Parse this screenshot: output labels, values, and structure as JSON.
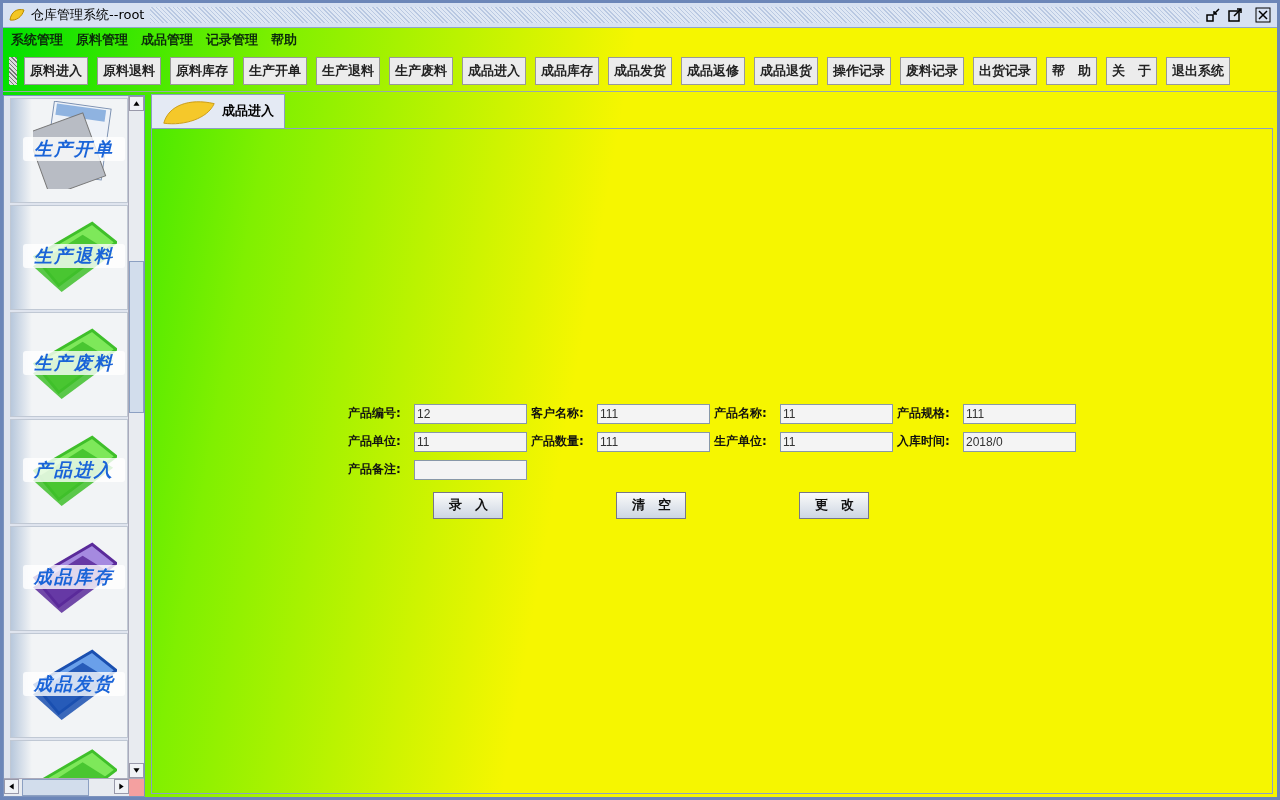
{
  "window": {
    "title": "仓库管理系统--root"
  },
  "menu": [
    "系统管理",
    "原料管理",
    "成品管理",
    "记录管理",
    "帮助"
  ],
  "toolbar": [
    "原料进入",
    "原料退料",
    "原料库存",
    "生产开单",
    "生产退料",
    "生产废料",
    "成品进入",
    "成品库存",
    "成品发货",
    "成品返修",
    "成品退货",
    "操作记录",
    "废料记录",
    "出货记录",
    "帮　助",
    "关　于",
    "退出系统"
  ],
  "sidebar": {
    "items": [
      {
        "label": "生产开单",
        "kind": "document"
      },
      {
        "label": "生产退料",
        "kind": "green-folder"
      },
      {
        "label": "生产废料",
        "kind": "green-folder"
      },
      {
        "label": "产品进入",
        "kind": "green-folder"
      },
      {
        "label": "成品库存",
        "kind": "purple-folder"
      },
      {
        "label": "成品发货",
        "kind": "blue-folder"
      },
      {
        "kind": "green-folder"
      }
    ]
  },
  "tabs": [
    {
      "label": "成品进入",
      "selected": true
    }
  ],
  "form": {
    "fields": [
      {
        "label": "产品编号:",
        "value": "12"
      },
      {
        "label": "客户名称:",
        "value": "111"
      },
      {
        "label": "产品名称:",
        "value": "11"
      },
      {
        "label": "产品规格:",
        "value": "111"
      },
      {
        "label": "产品单位:",
        "value": "11"
      },
      {
        "label": "产品数量:",
        "value": "111"
      },
      {
        "label": "生产单位:",
        "value": "11"
      },
      {
        "label": "入库时间:",
        "value": "2018/0"
      },
      {
        "label": "产品备注:"
      }
    ],
    "buttons": [
      "录　入",
      "清　空",
      "更　改"
    ]
  }
}
